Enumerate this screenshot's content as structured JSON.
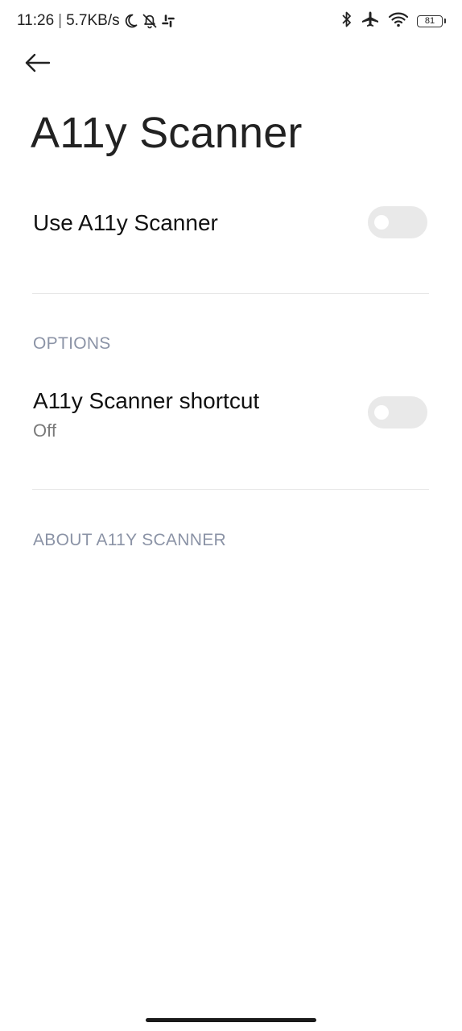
{
  "status_bar": {
    "time": "11:26",
    "separator": "|",
    "net_speed": "5.7KB/s",
    "icons_left": [
      "moon-icon",
      "bell-off-icon",
      "slack-icon"
    ],
    "icons_right": [
      "bluetooth-icon",
      "airplane-icon",
      "wifi-icon",
      "battery-icon"
    ],
    "battery_level": "81"
  },
  "app_bar": {
    "back_icon": "arrow-left-icon",
    "title": "A11y Scanner"
  },
  "settings": {
    "use_scanner": {
      "label": "Use A11y Scanner",
      "enabled": false
    },
    "options_header": "OPTIONS",
    "shortcut": {
      "label": "A11y Scanner shortcut",
      "summary": "Off",
      "enabled": false
    },
    "about_header": "ABOUT A11Y SCANNER"
  },
  "colors": {
    "toggle_off_track": "#e9e9e9",
    "section_header": "#8b93a6",
    "divider": "#e6e6e6"
  }
}
